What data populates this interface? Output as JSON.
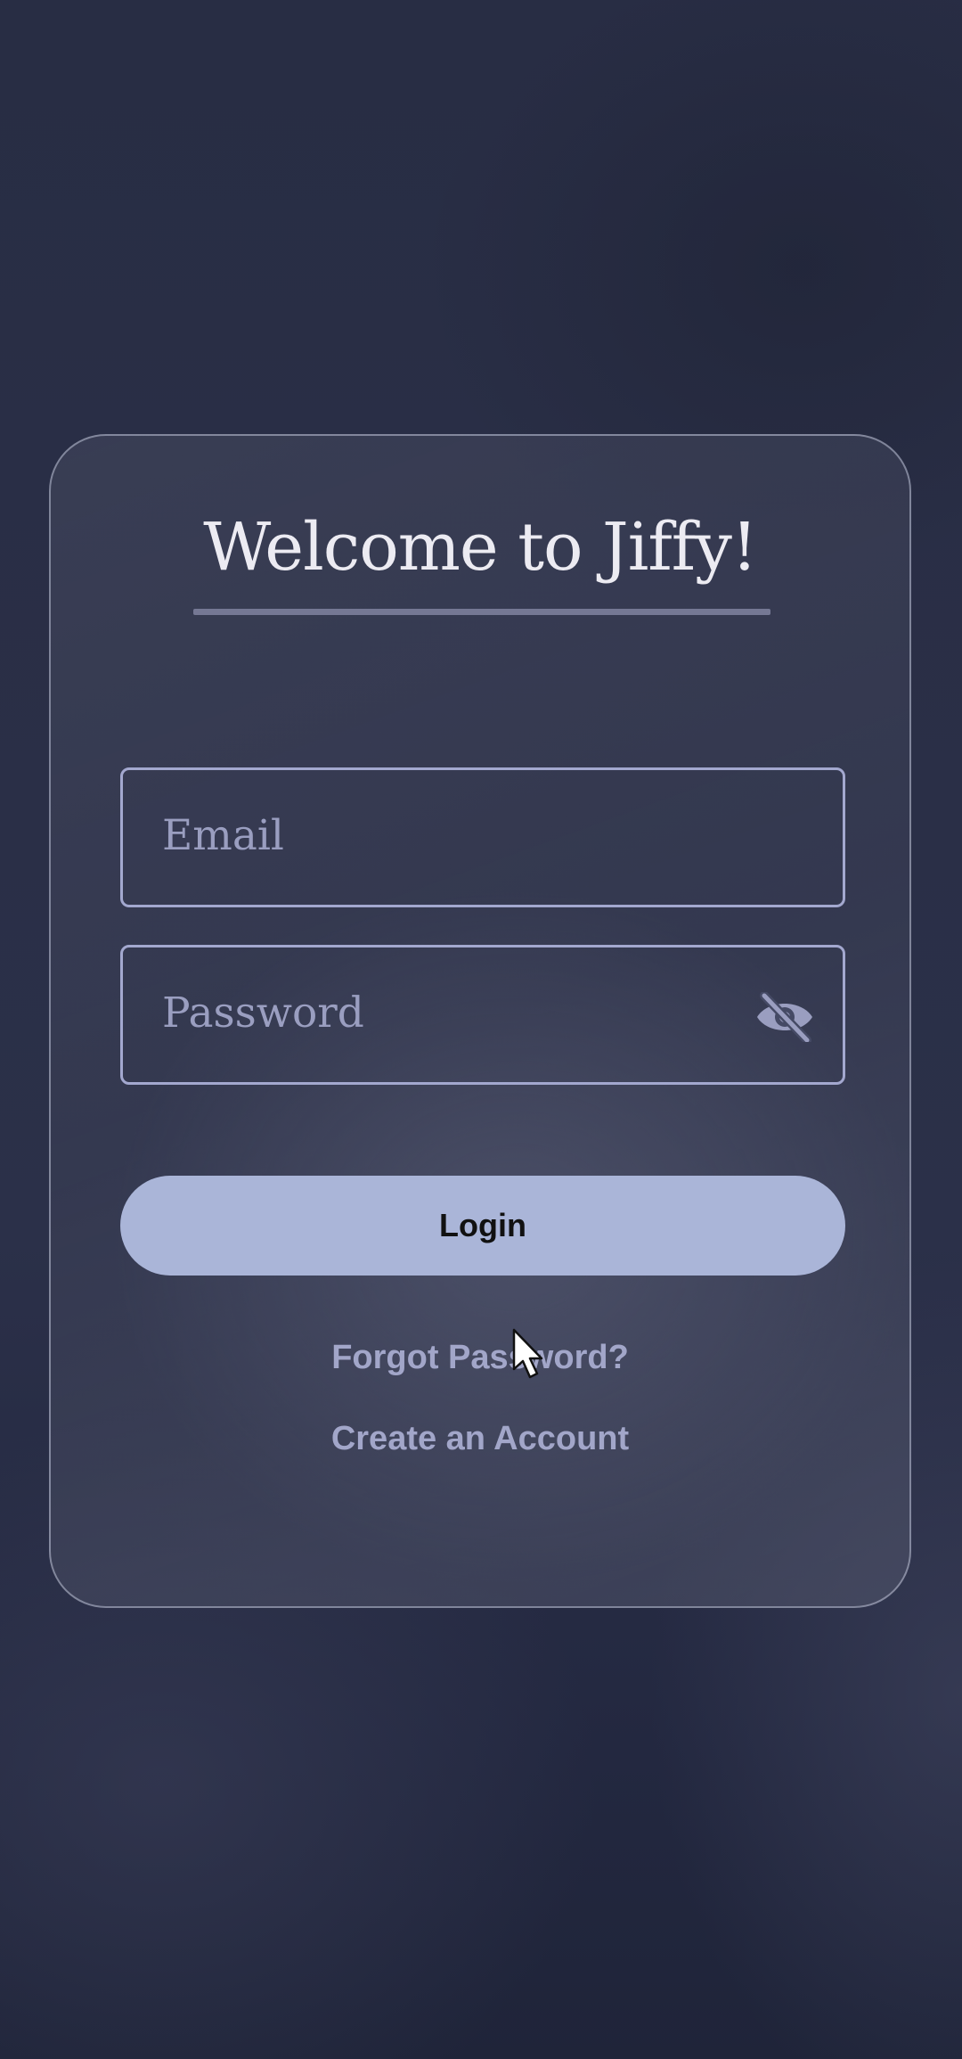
{
  "login_card": {
    "title": "Welcome to Jiffy!",
    "email_field": {
      "placeholder": "Email",
      "value": ""
    },
    "password_field": {
      "placeholder": "Password",
      "value": "",
      "toggle_icon": "eye-off-icon"
    },
    "login_label": "Login",
    "forgot_password_label": "Forgot Password?",
    "create_account_label": "Create an Account"
  },
  "colors": {
    "button_fill": "#aab5d8",
    "field_border": "#a3a8cf",
    "link_text": "#a2a6c9"
  }
}
